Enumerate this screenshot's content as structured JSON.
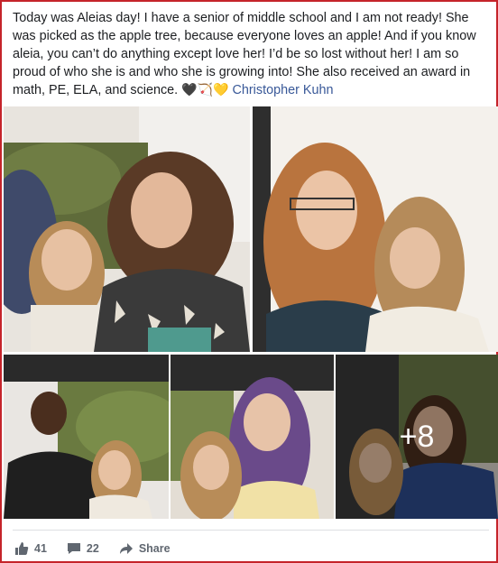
{
  "post": {
    "text": "Today was Aleias day! I have a senior of middle school and I am not ready! She was picked as the apple tree, because everyone loves an apple! And if you know aleia, you can’t do anything except love her! I’d be so lost without her! I am so proud of who she is and who she is growing into! She also received an award in math, PE, ELA, and science.",
    "emoji": "🖤🏹💛",
    "tagged_name": "Christopher Kuhn"
  },
  "photos": {
    "more_count": "+8"
  },
  "footer": {
    "likes": "41",
    "comments": "22",
    "share_label": "Share"
  },
  "icons": {
    "like": "thumbs-up-icon",
    "comment": "comment-icon",
    "share": "share-arrow-icon"
  },
  "colors": {
    "link": "#385898",
    "border": "#c5242a",
    "footer_text": "#606770"
  }
}
